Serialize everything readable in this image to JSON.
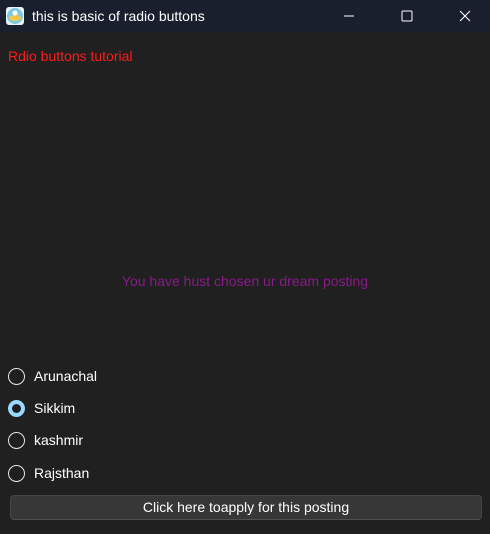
{
  "window": {
    "title": "this is basic of radio buttons",
    "controls": [
      "minimize-icon",
      "maximize-icon",
      "close-icon"
    ]
  },
  "heading": "Rdio buttons tutorial",
  "status_text": "You have hust chosen ur dream posting",
  "radio_options": [
    {
      "label": "Arunachal",
      "checked": false
    },
    {
      "label": "Sikkim",
      "checked": true
    },
    {
      "label": "kashmir",
      "checked": false
    },
    {
      "label": "Rajsthan",
      "checked": false
    }
  ],
  "apply_button": "Click here toapply for this posting",
  "colors": {
    "background": "#202020",
    "titlebar": "#1a1f2e",
    "heading": "#ff1a1a",
    "status": "#8a1a8a",
    "radio_accent": "#99d9ff",
    "button": "#373737"
  }
}
